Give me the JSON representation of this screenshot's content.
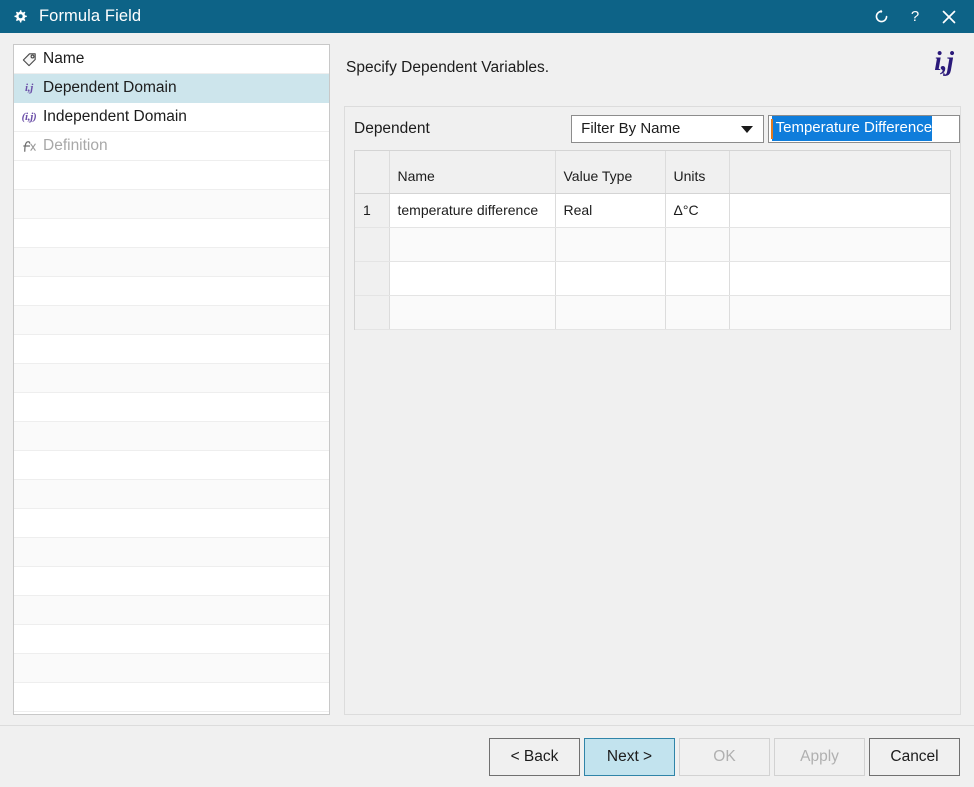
{
  "titlebar": {
    "title": "Formula Field",
    "app_icon": "gear-icon",
    "buttons": [
      {
        "name": "reset-icon",
        "label": "↺"
      },
      {
        "name": "help-icon",
        "label": "?"
      },
      {
        "name": "close-icon",
        "label": "✕"
      }
    ],
    "background": "#0d6387"
  },
  "sidebar": {
    "items": [
      {
        "label": "Name",
        "icon": "tag-icon",
        "state": "normal"
      },
      {
        "label": "Dependent Domain",
        "icon": "ij-icon",
        "icon_text": "i,j",
        "state": "selected"
      },
      {
        "label": "Independent Domain",
        "icon": "paren-ij-icon",
        "icon_text": "(i,j)",
        "state": "normal"
      },
      {
        "label": "Definition",
        "icon": "function-icon",
        "state": "disabled"
      }
    ],
    "selected_color": "#cde5ec",
    "empty_row_count": 19
  },
  "content": {
    "title": "Specify Dependent Variables.",
    "badge": "i,j",
    "badge_color": "#2b1a7a",
    "filter": {
      "label": "Dependent",
      "dropdown_value": "Filter By Name",
      "dropdown_options": [
        "Filter By Name"
      ],
      "search_value": "Temperature Difference",
      "search_selected": true,
      "selection_color": "#0f7ddb"
    },
    "table": {
      "columns": [
        "",
        "Name",
        "Value Type",
        "Units",
        ""
      ],
      "rows": [
        {
          "num": "1",
          "name": "temperature difference",
          "value_type": "Real",
          "units": "Δ°C",
          "extra": ""
        },
        {
          "num": "",
          "name": "",
          "value_type": "",
          "units": "",
          "extra": ""
        },
        {
          "num": "",
          "name": "",
          "value_type": "",
          "units": "",
          "extra": ""
        },
        {
          "num": "",
          "name": "",
          "value_type": "",
          "units": "",
          "extra": ""
        }
      ]
    }
  },
  "footer": {
    "buttons": [
      {
        "label": "< Back",
        "name": "back-button",
        "state": "normal"
      },
      {
        "label": "Next >",
        "name": "next-button",
        "state": "default"
      },
      {
        "label": "OK",
        "name": "ok-button",
        "state": "disabled"
      },
      {
        "label": "Apply",
        "name": "apply-button",
        "state": "disabled"
      },
      {
        "label": "Cancel",
        "name": "cancel-button",
        "state": "normal"
      }
    ]
  }
}
